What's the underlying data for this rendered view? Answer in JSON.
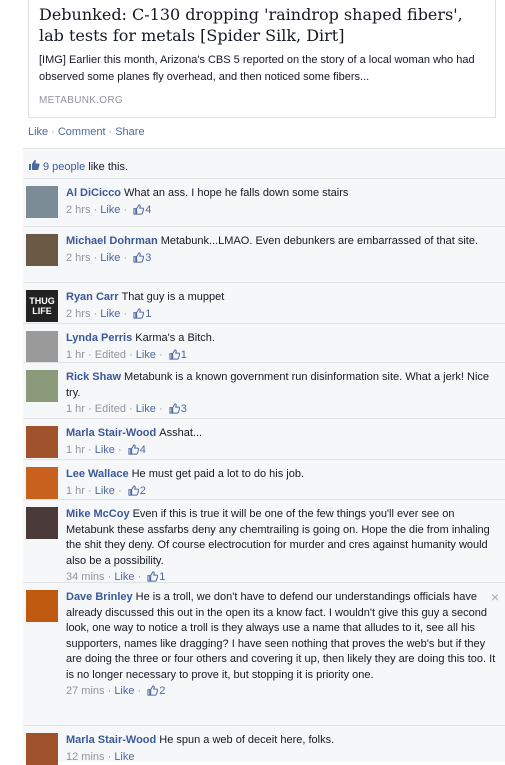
{
  "card": {
    "title": "Debunked: C-130 dropping 'raindrop shaped fibers', lab tests for metals [Spider Silk, Dirt]",
    "description": "[IMG] Earlier this month, Arizona's CBS 5 reported on the story of a local woman who had observed some planes fly overhead, and then noticed some fibers...",
    "domain": "METABUNK.ORG"
  },
  "actions": {
    "like": "Like",
    "comment": "Comment",
    "share": "Share"
  },
  "likes": {
    "people": "9 people",
    "suffix": " like this."
  },
  "comments": [
    {
      "name": "Al DiCicco",
      "text": "What an ass. I hope he falls down some stairs",
      "time": "2 hrs",
      "edited": "",
      "like": "Like",
      "count": "4",
      "avatar_color": "#7b8c96"
    },
    {
      "name": "Michael Dohrman",
      "text": "Metabunk...LMAO. Even debunkers are embarrassed of that site.",
      "time": "2 hrs",
      "edited": "",
      "like": "Like",
      "count": "3",
      "avatar_color": "#6a5a45"
    },
    {
      "name": "Ryan Carr",
      "text": "That guy is a muppet",
      "time": "2 hrs",
      "edited": "",
      "like": "Like",
      "count": "1",
      "avatar_color": "#222222",
      "avatar_text": "THUG LIFE"
    },
    {
      "name": "Lynda Perris",
      "text": "Karma's a Bitch.",
      "time": "1 hr",
      "edited": "Edited",
      "like": "Like",
      "count": "1",
      "avatar_color": "#9a9a9a"
    },
    {
      "name": "Rick Shaw",
      "text": "Metabunk is a known government run disinformation site. What a jerk! Nice try.",
      "time": "1 hr",
      "edited": "Edited",
      "like": "Like",
      "count": "3",
      "avatar_color": "#8b9a7a"
    },
    {
      "name": "Marla Stair-Wood",
      "text": "Asshat...",
      "time": "1 hr",
      "edited": "",
      "like": "Like",
      "count": "4",
      "avatar_color": "#a0522d"
    },
    {
      "name": "Lee Wallace",
      "text": "He must get paid a lot to do his job.",
      "time": "1 hr",
      "edited": "",
      "like": "Like",
      "count": "2",
      "avatar_color": "#c8611e"
    },
    {
      "name": "Mike McCoy",
      "text": "Even if this is true it will be one of the few things you'll ever see on Metabunk these assfarbs deny any chemtrailing is going on. Hope the die from inhaling the shit they deny. Of course electrocution for murder and cres against humanity would also be a possibility.",
      "time": "34 mins",
      "edited": "",
      "like": "Like",
      "count": "1",
      "avatar_color": "#4a3a3a"
    },
    {
      "name": "Dave Brinley",
      "text": "He is a troll, we don't have to defend our understandings officials have already discussed this out in the open its a know fact. I wouldn't give this guy a second look, one way to notice a troll is they always use a name that alludes to it, see all his supporters, names like dragging? I have seen nothing that proves the web's but if they are doing the three or four others and covering it up, then likely they are doing this too. It is no longer necessary to prove it, but stopping it is priority one.",
      "time": "27 mins",
      "edited": "",
      "like": "Like",
      "count": "2",
      "avatar_color": "#c05a10",
      "closable": true
    },
    {
      "name": "Marla Stair-Wood",
      "text": "He spun a web of deceit here, folks.",
      "time": "12 mins",
      "edited": "",
      "like": "Like",
      "count": "",
      "avatar_color": "#a0522d"
    }
  ],
  "close_symbol": "×"
}
